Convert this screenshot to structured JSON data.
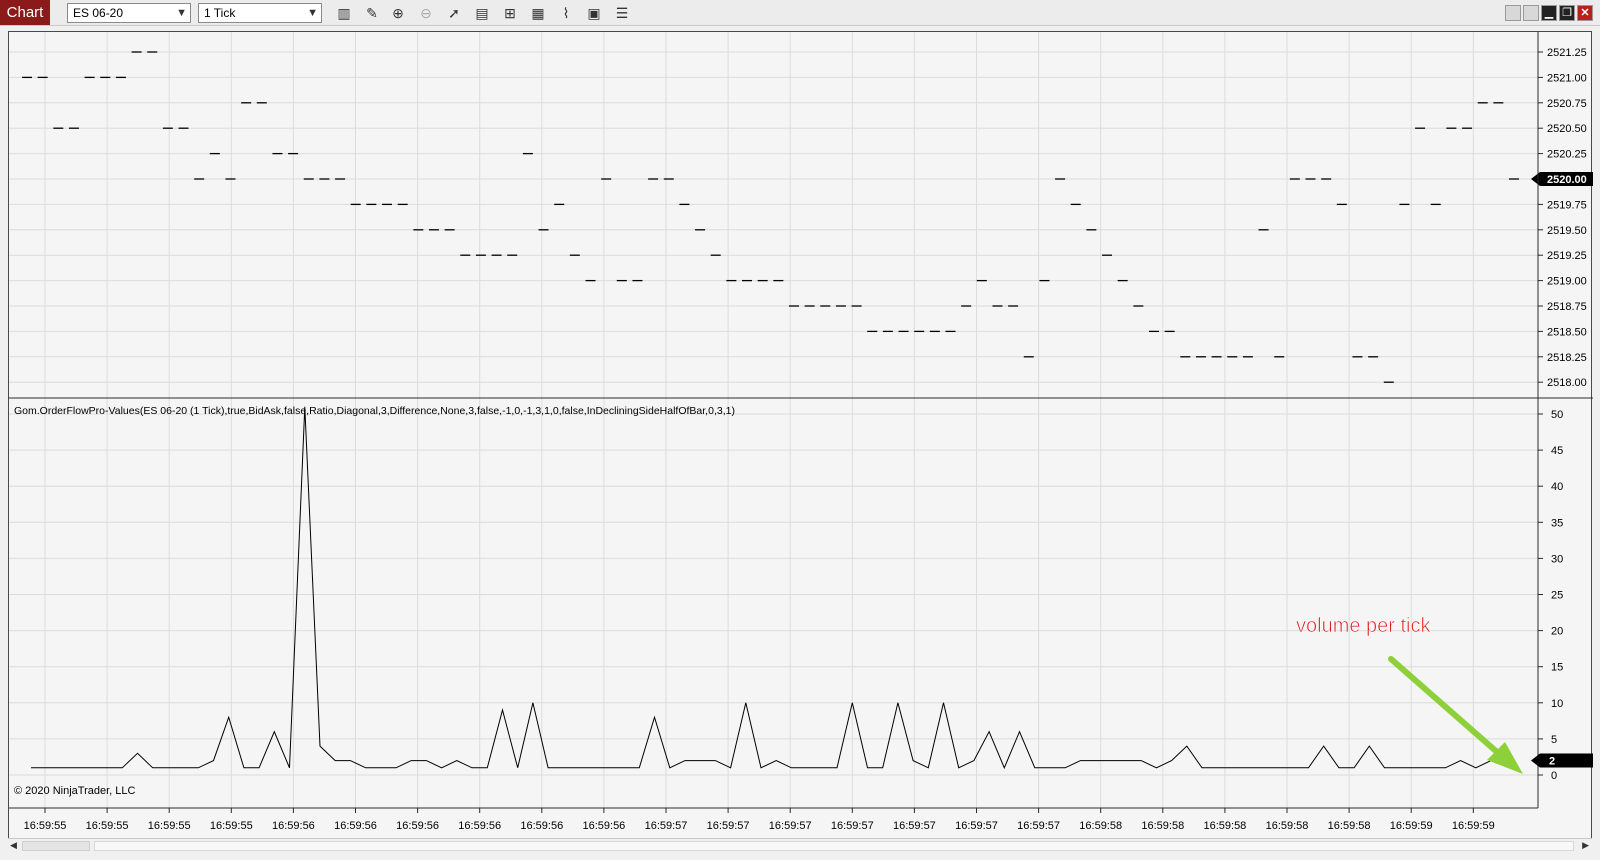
{
  "toolbar": {
    "chart_tab_label": "Chart",
    "instrument": "ES 06-20",
    "interval": "1 Tick",
    "tools": [
      "bars-type-icon",
      "draw-pencil-icon",
      "zoom-in-icon",
      "zoom-out-icon",
      "pointer-icon",
      "properties-icon",
      "strategies-icon",
      "indicators-icon",
      "drawing-tools-icon",
      "data-box-icon",
      "chart-trader-icon"
    ]
  },
  "window_controls": [
    "tab-a",
    "tab-b",
    "minimize",
    "restore",
    "close"
  ],
  "price_panel": {
    "y_ticks": [
      "2521.25",
      "2521.00",
      "2520.75",
      "2520.50",
      "2520.25",
      "2520.00",
      "2519.75",
      "2519.50",
      "2519.25",
      "2519.00",
      "2518.75",
      "2518.50",
      "2518.25",
      "2518.00"
    ],
    "last_price": "2520.00",
    "bar_prices": [
      2521.0,
      2521.0,
      2520.5,
      2520.5,
      2521.0,
      2521.0,
      2521.0,
      2521.25,
      2521.25,
      2520.5,
      2520.5,
      2520.0,
      2520.25,
      2520.0,
      2520.75,
      2520.75,
      2520.25,
      2520.25,
      2520.0,
      2520.0,
      2520.0,
      2519.75,
      2519.75,
      2519.75,
      2519.75,
      2519.5,
      2519.5,
      2519.5,
      2519.25,
      2519.25,
      2519.25,
      2519.25,
      2520.25,
      2519.5,
      2519.75,
      2519.25,
      2519.0,
      2520.0,
      2519.0,
      2519.0,
      2520.0,
      2520.0,
      2519.75,
      2519.5,
      2519.25,
      2519.0,
      2519.0,
      2519.0,
      2519.0,
      2518.75,
      2518.75,
      2518.75,
      2518.75,
      2518.75,
      2518.5,
      2518.5,
      2518.5,
      2518.5,
      2518.5,
      2518.5,
      2518.75,
      2519.0,
      2518.75,
      2518.75,
      2518.25,
      2519.0,
      2520.0,
      2519.75,
      2519.5,
      2519.25,
      2519.0,
      2518.75,
      2518.5,
      2518.5,
      2518.25,
      2518.25,
      2518.25,
      2518.25,
      2518.25,
      2519.5,
      2518.25,
      2520.0,
      2520.0,
      2520.0,
      2519.75,
      2518.25,
      2518.25,
      2518.0,
      2519.75,
      2520.5,
      2519.75,
      2520.5,
      2520.5,
      2520.75,
      2520.75,
      2520.0
    ]
  },
  "indicator_panel": {
    "label": "Gom.OrderFlowPro-Values(ES 06-20 (1 Tick),true,BidAsk,false,Ratio,Diagonal,3,Difference,None,3,false,-1,0,-1,3,1,0,false,InDecliningSideHalfOfBar,0,3,1)",
    "copyright": "© 2020 NinjaTrader, LLC",
    "y_ticks": [
      "50",
      "45",
      "40",
      "35",
      "30",
      "25",
      "20",
      "15",
      "10",
      "5",
      "0"
    ],
    "last_value": "2",
    "annotation": "volume per tick",
    "values": [
      1,
      1,
      1,
      1,
      1,
      1,
      1,
      3,
      1,
      1,
      1,
      1,
      2,
      8,
      1,
      1,
      6,
      1,
      51,
      4,
      2,
      2,
      1,
      1,
      1,
      2,
      2,
      1,
      2,
      1,
      1,
      9,
      1,
      10,
      1,
      1,
      1,
      1,
      1,
      1,
      1,
      8,
      1,
      2,
      2,
      2,
      1,
      10,
      1,
      2,
      1,
      1,
      1,
      1,
      10,
      1,
      1,
      10,
      2,
      1,
      10,
      1,
      2,
      6,
      1,
      6,
      1,
      1,
      1,
      2,
      2,
      2,
      2,
      2,
      1,
      2,
      4,
      1,
      1,
      1,
      1,
      1,
      1,
      1,
      1,
      4,
      1,
      1,
      4,
      1,
      1,
      1,
      1,
      1,
      2,
      1,
      2
    ]
  },
  "time_axis": {
    "labels": [
      "16:59:55",
      "16:59:55",
      "16:59:55",
      "16:59:55",
      "16:59:56",
      "16:59:56",
      "16:59:56",
      "16:59:56",
      "16:59:56",
      "16:59:56",
      "16:59:57",
      "16:59:57",
      "16:59:57",
      "16:59:57",
      "16:59:57",
      "16:59:57",
      "16:59:57",
      "16:59:58",
      "16:59:58",
      "16:59:58",
      "16:59:58",
      "16:59:58",
      "16:59:59",
      "16:59:59"
    ]
  },
  "colors": {
    "chart_tab": "#8b1a1a",
    "annotation_text": "#e02020",
    "annotation_arrow": "#8dd03a",
    "price_marker_bg": "#000000"
  }
}
